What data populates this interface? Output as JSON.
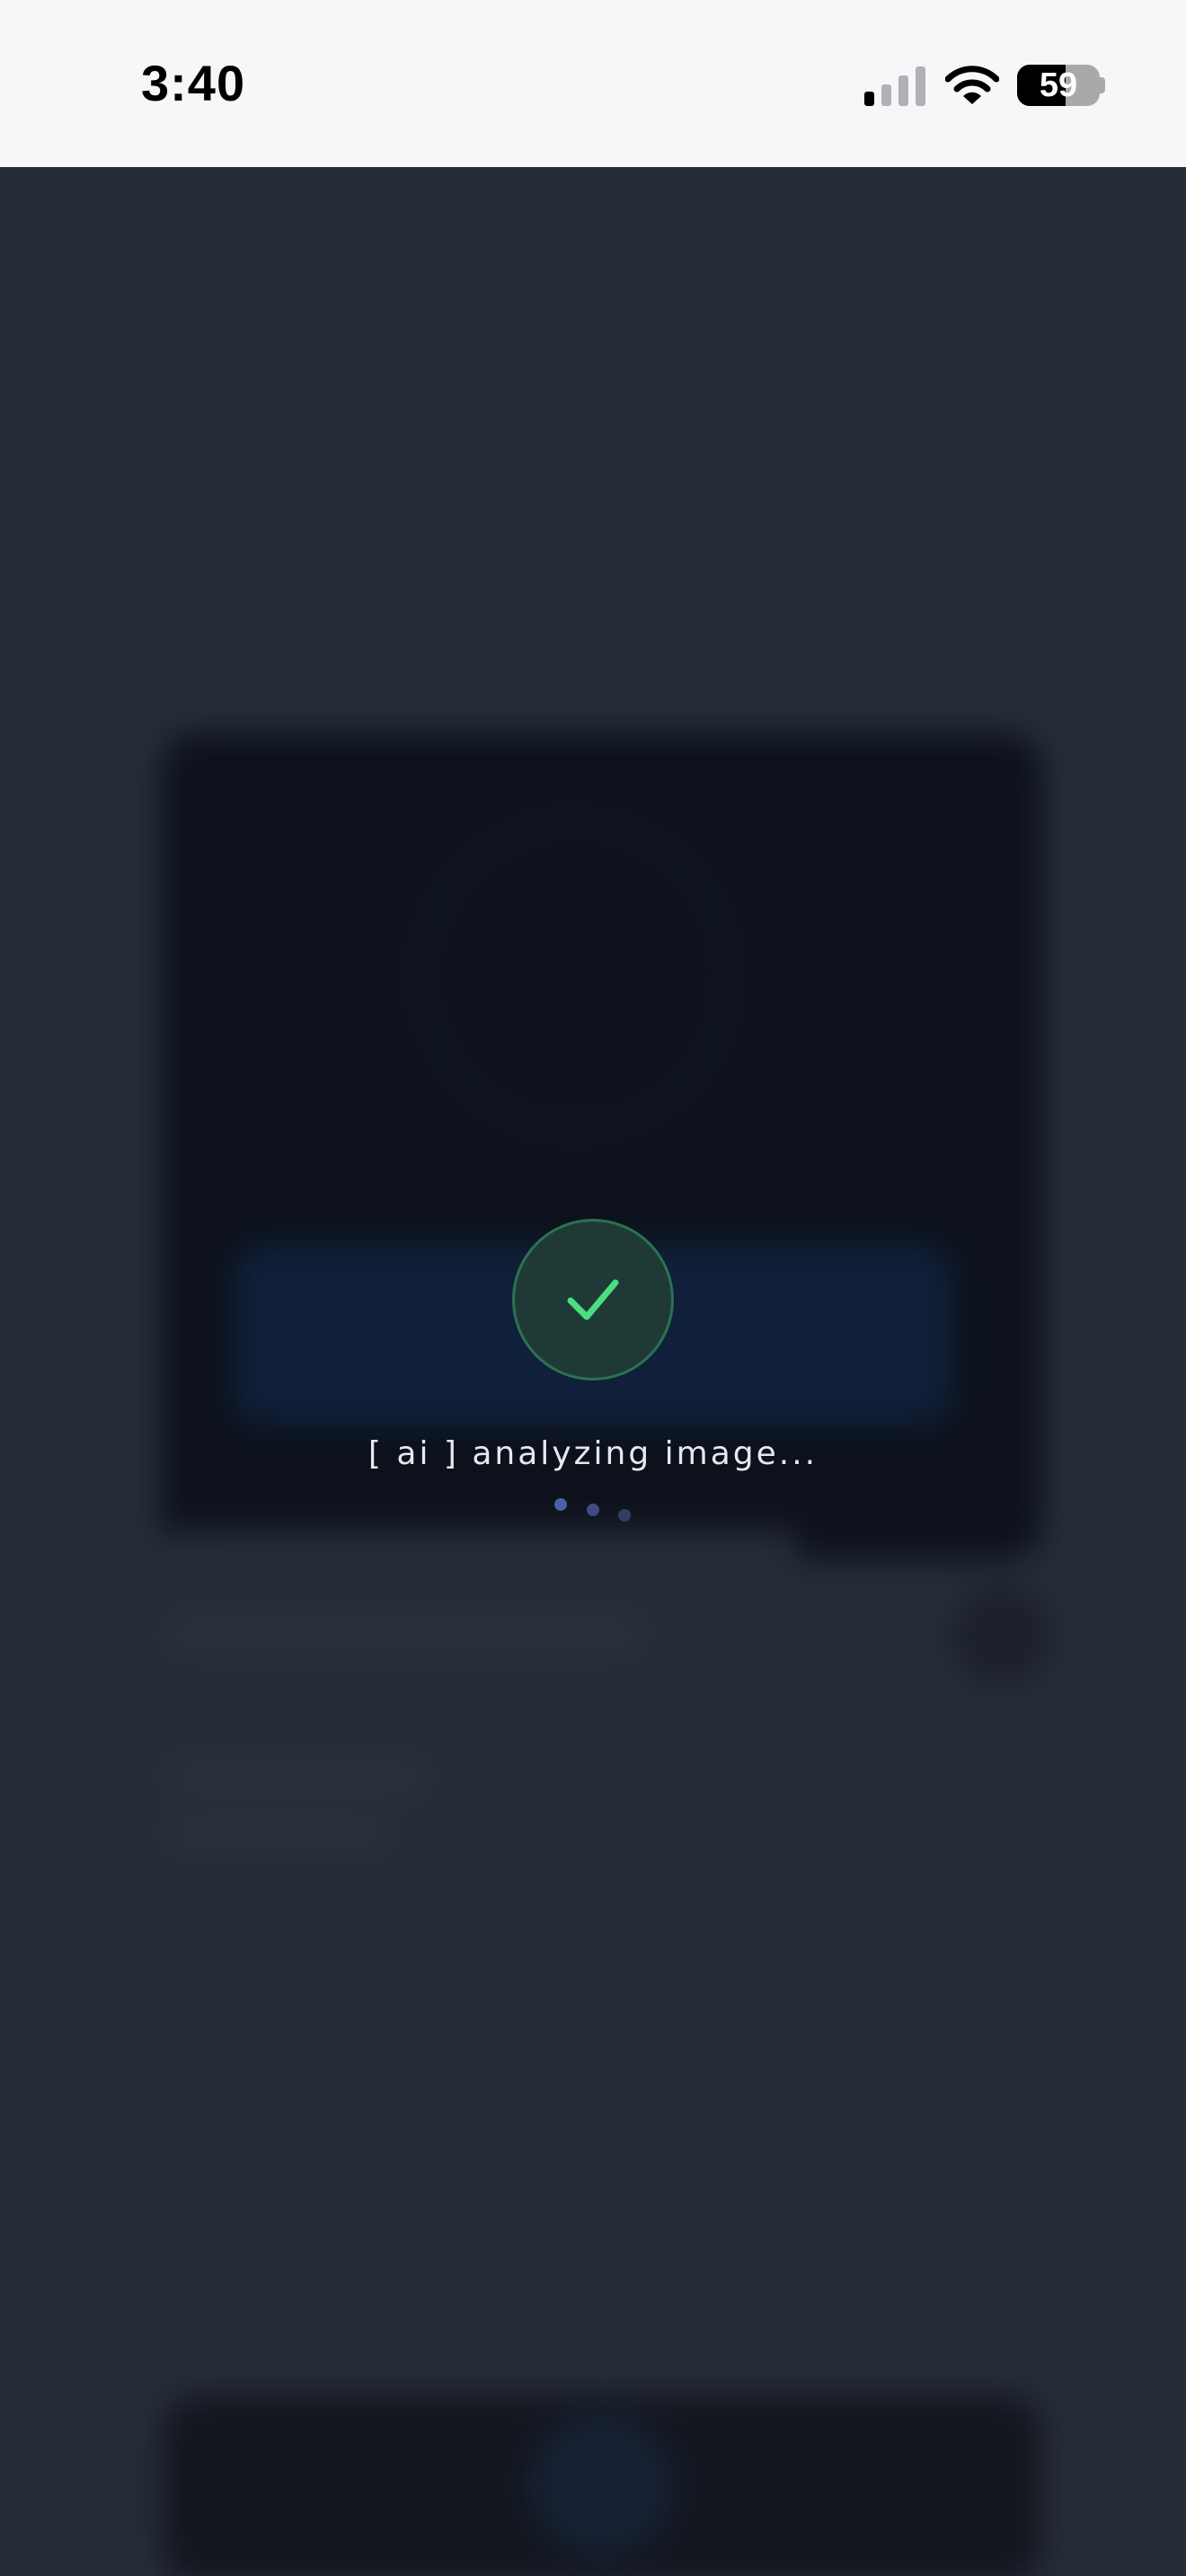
{
  "status_bar": {
    "time": "3:40",
    "signal_bars_active": 1,
    "signal_bars_total": 4,
    "battery_level": "59",
    "battery_fraction": 0.59,
    "icons": {
      "signal": "cellular-signal-icon",
      "wifi": "wifi-icon",
      "battery": "battery-icon"
    }
  },
  "overlay": {
    "icon": "checkmark-icon",
    "message": "[ ai ] analyzing image...",
    "loading_dots": 3,
    "colors": {
      "badge_fill": "#1f3a36",
      "badge_border": "#2c7251",
      "check": "#4ade80",
      "text": "#e6e8ee",
      "dot_1": "#4c5fa0",
      "dot_2": "#3d4c80",
      "dot_3": "#323d62"
    }
  },
  "background": {
    "state": "blurred",
    "color": "#272d38"
  }
}
